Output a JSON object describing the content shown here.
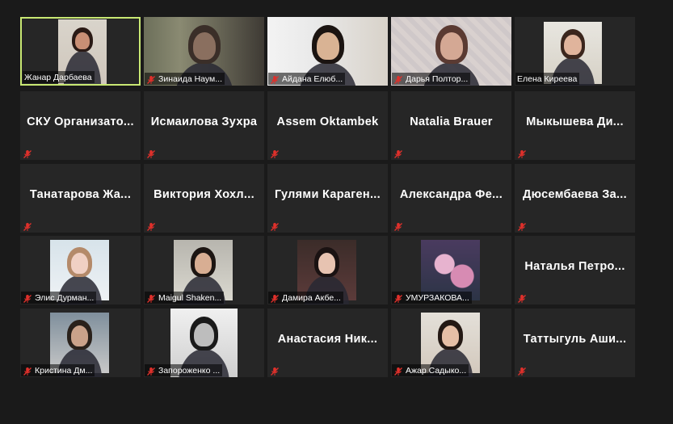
{
  "participants": [
    {
      "name": "Жанар Дарбаева",
      "video": true,
      "active": true,
      "muted": false
    },
    {
      "name": "Зинаида Наум...",
      "video": true,
      "muted": true
    },
    {
      "name": "Айдана Елюб...",
      "video": true,
      "muted": true
    },
    {
      "name": "Дарья Полтор...",
      "video": true,
      "muted": true
    },
    {
      "name": "Елена Киреева",
      "video": true,
      "muted": false
    },
    {
      "name": "СКУ Организато...",
      "video": false,
      "muted": true
    },
    {
      "name": "Исмаилова Зухра",
      "video": false,
      "muted": true
    },
    {
      "name": "Assem Oktambek",
      "video": false,
      "muted": true
    },
    {
      "name": "Natalia Brauer",
      "video": false,
      "muted": true
    },
    {
      "name": "Мыкышева Ди...",
      "video": false,
      "muted": true
    },
    {
      "name": "Танатарова Жа...",
      "video": false,
      "muted": true
    },
    {
      "name": "Виктория Хохл...",
      "video": false,
      "muted": true
    },
    {
      "name": "Гулями Караген...",
      "video": false,
      "muted": true
    },
    {
      "name": "Александра Фе...",
      "video": false,
      "muted": true
    },
    {
      "name": "Дюсембаева За...",
      "video": false,
      "muted": true
    },
    {
      "name": "Элис Дурман...",
      "video": true,
      "muted": true
    },
    {
      "name": "Maigul Shaken...",
      "video": true,
      "muted": true
    },
    {
      "name": "Дамира Акбе...",
      "video": true,
      "muted": true
    },
    {
      "name": "УМУРЗАКОВА...",
      "video": true,
      "muted": true
    },
    {
      "name": "Наталья Петро...",
      "video": false,
      "muted": true
    },
    {
      "name": "Кристина Дм...",
      "video": true,
      "muted": true
    },
    {
      "name": "Запороженко ...",
      "video": true,
      "muted": true
    },
    {
      "name": "Анастасия Ник...",
      "video": false,
      "muted": true
    },
    {
      "name": "Ажар Садыко...",
      "video": true,
      "muted": true
    },
    {
      "name": "Таттыгуль Аши...",
      "video": false,
      "muted": true
    }
  ],
  "colors": {
    "background": "#1a1a1a",
    "tile": "#262626",
    "active_border": "#c8e873",
    "mute_red": "#e0302b"
  },
  "icons": {
    "muted": "muted-mic-icon"
  }
}
